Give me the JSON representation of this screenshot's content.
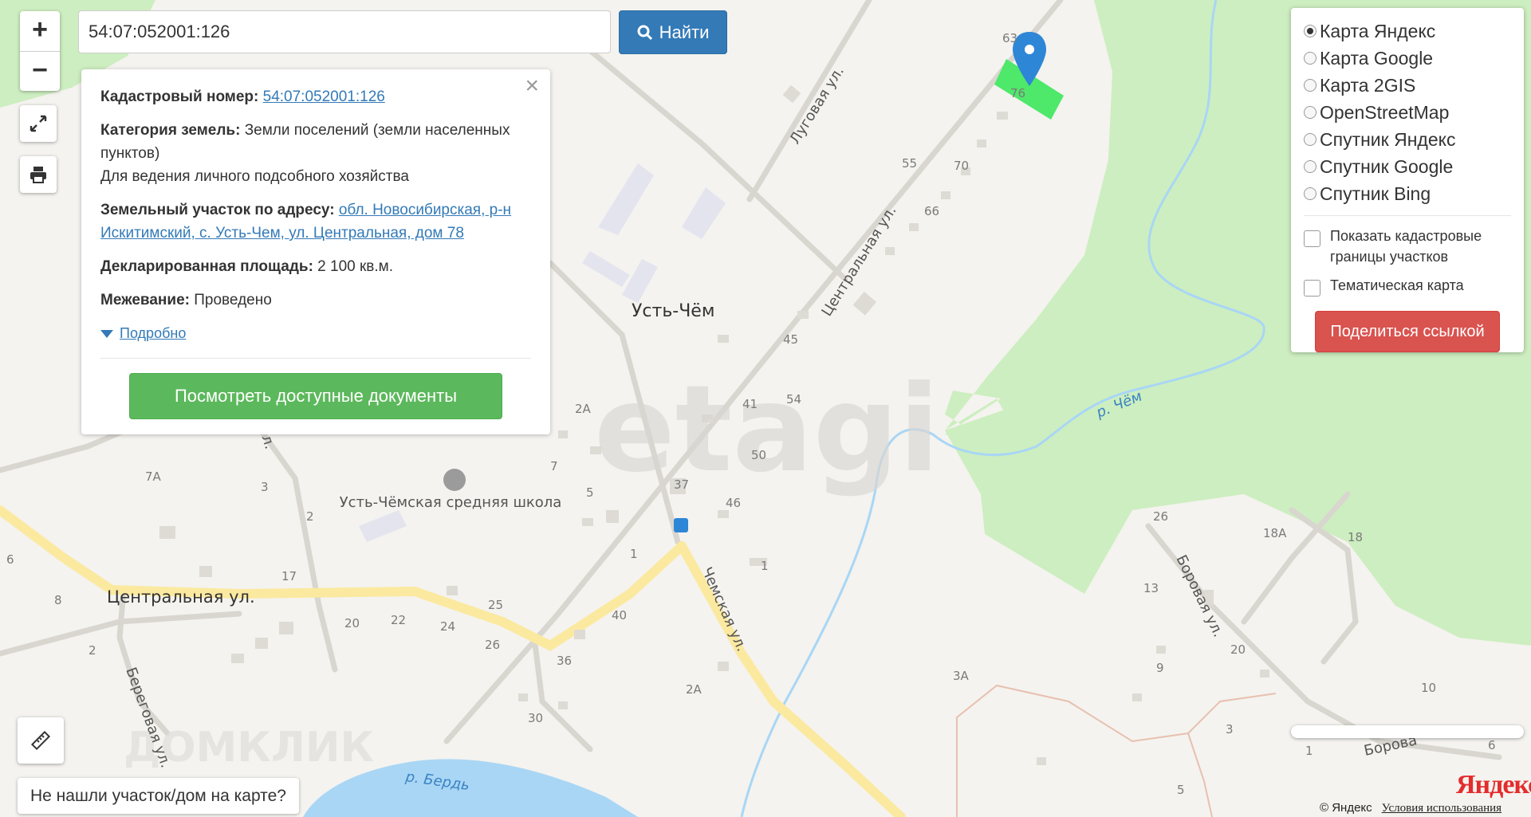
{
  "search": {
    "value": "54:07:052001:126",
    "button_label": "Найти"
  },
  "zoom": {
    "in_label": "+",
    "out_label": "−"
  },
  "info_panel": {
    "cadastral_label": "Кадастровый номер:",
    "cadastral_value": "54:07:052001:126",
    "category_label": "Категория земель:",
    "category_value": "Земли поселений (земли населенных пунктов)",
    "usage_value": "Для ведения личного подсобного хозяйства",
    "address_label": "Земельный участок по адресу:",
    "address_value": "обл. Новосибирская, р-н Искитимский, с. Усть-Чем, ул. Центральная, дом 78",
    "area_label": "Декларированная площадь:",
    "area_value": "2 100 кв.м.",
    "survey_label": "Межевание:",
    "survey_value": "Проведено",
    "details_label": "Подробно",
    "docs_button": "Посмотреть доступные документы",
    "close_glyph": "×"
  },
  "layers": {
    "options": [
      "Карта Яндекс",
      "Карта Google",
      "Карта 2GIS",
      "OpenStreetMap",
      "Спутник Яндекс",
      "Спутник Google",
      "Спутник Bing"
    ],
    "selected": "Карта Яндекс",
    "show_cadastral": "Показать кадастровые границы участков",
    "thematic": "Тематическая карта",
    "share_button": "Поделиться ссылкой"
  },
  "not_found_button": "Не нашли участок/дом на карте?",
  "map": {
    "village": "Усть-Чём",
    "school": "Усть-Чёмская средняя школа",
    "streets": {
      "central": "Центральная ул.",
      "central_diag": "Центральная ул.",
      "lugovaya": "Луговая ул.",
      "chemskaya": "Чемская ул.",
      "beregovaya": "Береговая ул.",
      "borovaya": "Боровая ул.",
      "borovaya2": "Борова",
      "ul_short": "ул."
    },
    "rivers": {
      "chem": "р. Чём",
      "berd": "р. Бердь"
    },
    "house_numbers": {
      "n63": "63",
      "n76": "76",
      "n55": "55",
      "n70": "70",
      "n66": "66",
      "n45": "45",
      "n41": "41",
      "n54": "54",
      "n50": "50",
      "n37": "37",
      "n46": "46",
      "n2A": "2А",
      "n7": "7",
      "n5": "5",
      "n1": "1",
      "n1b": "1",
      "n7A": "7А",
      "n3": "3",
      "n2": "2",
      "n17": "17",
      "n6": "6",
      "n8": "8",
      "n2c": "2",
      "n20": "20",
      "n22": "22",
      "n24": "24",
      "n25": "25",
      "n26": "26",
      "n36": "36",
      "n40": "40",
      "n2A2": "2А",
      "n30": "30",
      "n26b": "26",
      "n18A": "18А",
      "n18": "18",
      "n13": "13",
      "n20b": "20",
      "n9": "9",
      "n3A": "3А",
      "n10": "10",
      "n3b": "3",
      "n1c": "1",
      "n5b": "5",
      "n6b": "6"
    },
    "watermark": "etagi",
    "watermark2": "ДОМКЛИК"
  },
  "yandex_logo": "Яндекс",
  "copyright": {
    "text": "© Яндекс",
    "terms": "Условия использования"
  },
  "colors": {
    "forest": "#cdeec0",
    "parcel": "#4ee86a",
    "pin": "#2e86d6",
    "road_major": "#fbe9a0",
    "water": "#a9d6f5",
    "search_button": "#337ab7",
    "docs_button": "#5cb85c",
    "share_button": "#d9534f"
  }
}
